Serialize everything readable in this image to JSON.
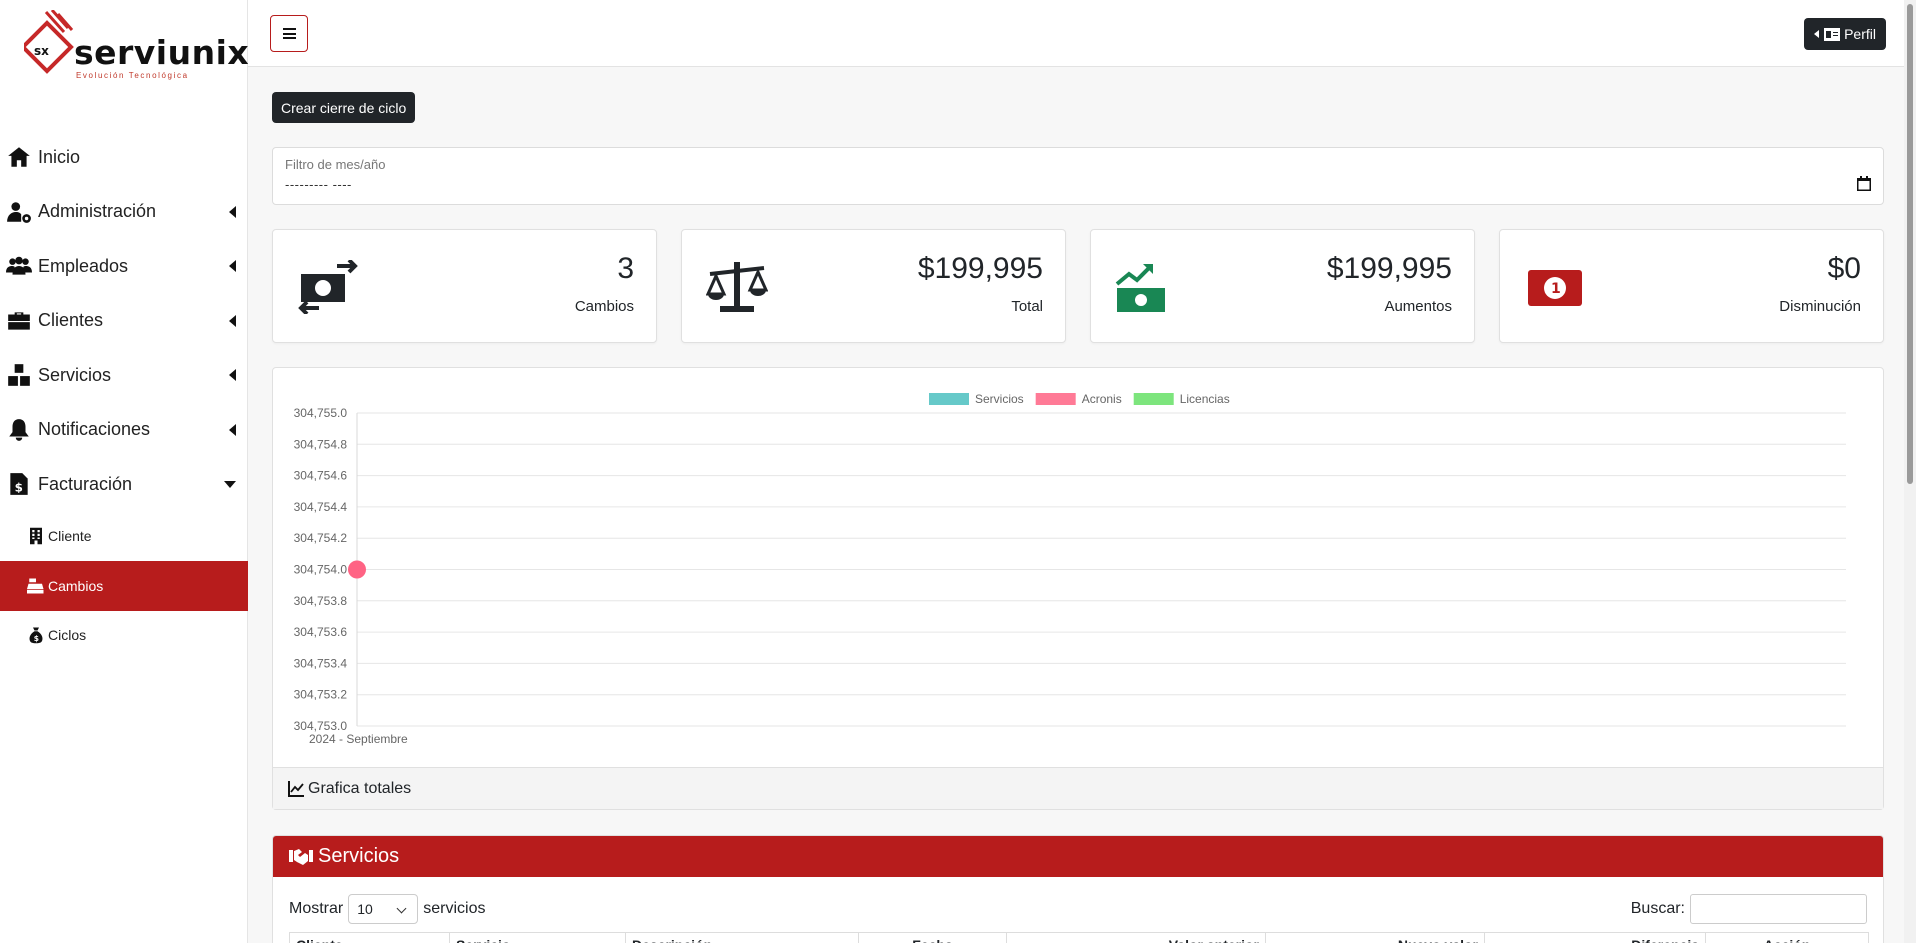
{
  "brand": {
    "name": "serviunix",
    "tagline": "Evolución Tecnológica",
    "badge": "SX"
  },
  "sidebar": {
    "items": [
      {
        "label": "Inicio",
        "icon": "home-icon"
      },
      {
        "label": "Administración",
        "icon": "user-gear-icon"
      },
      {
        "label": "Empleados",
        "icon": "users-icon"
      },
      {
        "label": "Clientes",
        "icon": "briefcase-icon"
      },
      {
        "label": "Servicios",
        "icon": "boxes-icon"
      },
      {
        "label": "Notificaciones",
        "icon": "bell-icon"
      },
      {
        "label": "Facturación",
        "icon": "invoice-dollar-icon"
      }
    ],
    "subitems": [
      {
        "label": "Cliente",
        "icon": "building-icon"
      },
      {
        "label": "Cambios",
        "icon": "cash-register-icon",
        "active": true
      },
      {
        "label": "Ciclos",
        "icon": "money-bag-icon"
      }
    ]
  },
  "topbar": {
    "profile_label": "Perfil"
  },
  "main": {
    "create_button": "Crear cierre de ciclo",
    "filter": {
      "label": "Filtro de mes/año",
      "value": "--------- ----"
    }
  },
  "cards": [
    {
      "value": "3",
      "label": "Cambios",
      "icon": "money-exchange-icon",
      "color": "#212529"
    },
    {
      "value": "$199,995",
      "label": "Total",
      "icon": "scale-icon",
      "color": "#212529"
    },
    {
      "value": "$199,995",
      "label": "Aumentos",
      "icon": "money-trend-up-icon",
      "color": "#198754"
    },
    {
      "value": "$0",
      "label": "Disminución",
      "icon": "money-bill-icon",
      "color": "#b71c1c"
    }
  ],
  "chart_footer": "Grafica totales",
  "chart_data": {
    "type": "line",
    "categories": [
      "2024 - Septiembre"
    ],
    "series": [
      {
        "name": "Servicios",
        "color": "#4bc0c0",
        "values": [
          null
        ]
      },
      {
        "name": "Acronis",
        "color": "#ff6384",
        "values": [
          304754.0
        ]
      },
      {
        "name": "Licencias",
        "color": "#66e066",
        "values": [
          null
        ]
      }
    ],
    "y_ticks": [
      "304,755.0",
      "304,754.8",
      "304,754.6",
      "304,754.4",
      "304,754.2",
      "304,754.0",
      "304,753.8",
      "304,753.6",
      "304,753.4",
      "304,753.2",
      "304,753.0"
    ],
    "ylim": [
      304753.0,
      304755.0
    ],
    "grid": true,
    "legend": "top"
  },
  "servicios": {
    "title": "Servicios",
    "show_prefix": "Mostrar",
    "show_value": "10",
    "show_suffix": "servicios",
    "search_label": "Buscar:",
    "columns": [
      "Cliente",
      "Servicio",
      "Descripción",
      "Fecha",
      "Valor anterior",
      "Nuevo valor",
      "Diferencia",
      "Acción"
    ]
  },
  "colors": {
    "accent": "#b71c1c",
    "dark": "#212529",
    "success": "#198754"
  }
}
